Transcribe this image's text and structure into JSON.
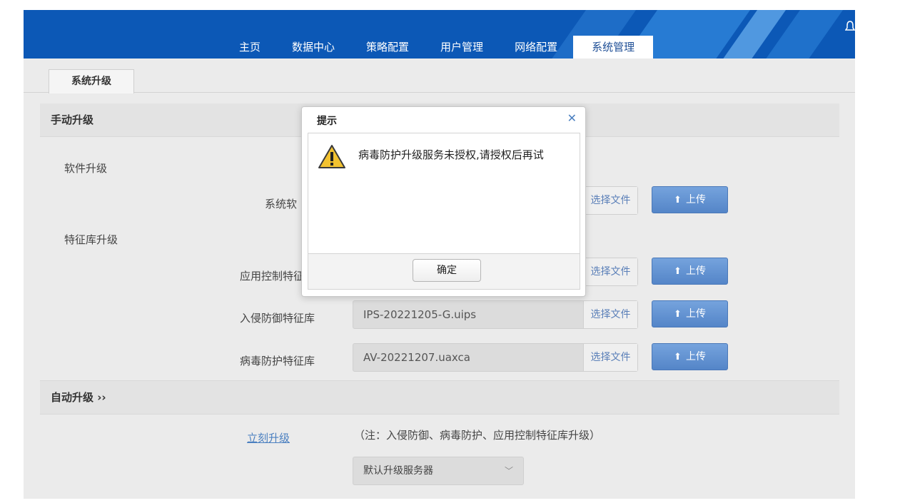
{
  "nav": {
    "items": [
      {
        "label": "主页"
      },
      {
        "label": "数据中心"
      },
      {
        "label": "策略配置"
      },
      {
        "label": "用户管理"
      },
      {
        "label": "网络配置"
      },
      {
        "label": "系统管理"
      }
    ],
    "active": "系统管理"
  },
  "tabs": {
    "active_label": "系统升级"
  },
  "manual": {
    "title": "手动升级",
    "software_label": "软件升级",
    "system_row_label": "系统软",
    "signature_label": "特征库升级",
    "app_control_label": "应用控制特征",
    "ips_label": "入侵防御特征库",
    "ips_file": "IPS-20221205-G.uips",
    "av_label": "病毒防护特征库",
    "av_file": "AV-20221207.uaxca",
    "select_file_label": "选择文件",
    "upload_label": "上传"
  },
  "auto": {
    "title": "自动升级 ››",
    "upgrade_now_link": "立刻升级",
    "note": "（注：入侵防御、病毒防护、应用控制特征库升级）",
    "server_selected": "默认升级服务器"
  },
  "modal": {
    "title": "提示",
    "message": "病毒防护升级服务未授权,请授权后再试",
    "ok_label": "确定"
  },
  "colors": {
    "header_bg": "#0c58b6",
    "upload_btn": "#5f8fd0",
    "link": "#4a7fc0"
  },
  "icons": {
    "close": "close-icon",
    "warning": "warning-icon",
    "upload": "upload-icon",
    "bell": "bell-icon",
    "chevron": "chevron-down-icon"
  }
}
